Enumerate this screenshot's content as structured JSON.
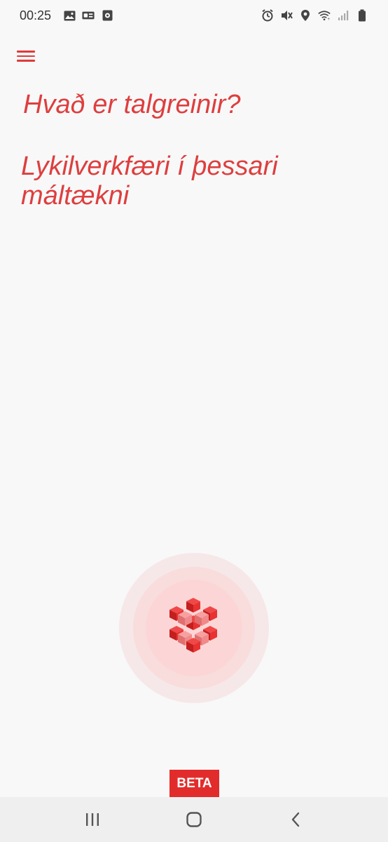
{
  "status_bar": {
    "time": "00:25",
    "left_icons": [
      "gallery-icon",
      "messenger-icon",
      "tv-icon"
    ],
    "right_icons": [
      "alarm-icon",
      "mute-icon",
      "location-icon",
      "wifi-icon",
      "signal-icon",
      "battery-icon"
    ]
  },
  "menu": {
    "icon": "hamburger-menu-icon"
  },
  "suggestions": [
    {
      "text": "Hvað er talgreinir?"
    },
    {
      "text": "Lykilverkfæri í þessari máltækni"
    }
  ],
  "record_button": {
    "icon": "cube-logo-icon"
  },
  "badge": {
    "label": "BETA"
  },
  "nav": {
    "recents_icon": "recents-icon",
    "home_icon": "home-icon",
    "back_icon": "back-icon"
  },
  "colors": {
    "accent": "#de3e3e",
    "badge_bg": "#e22c2c",
    "background": "#f8f8f8"
  }
}
